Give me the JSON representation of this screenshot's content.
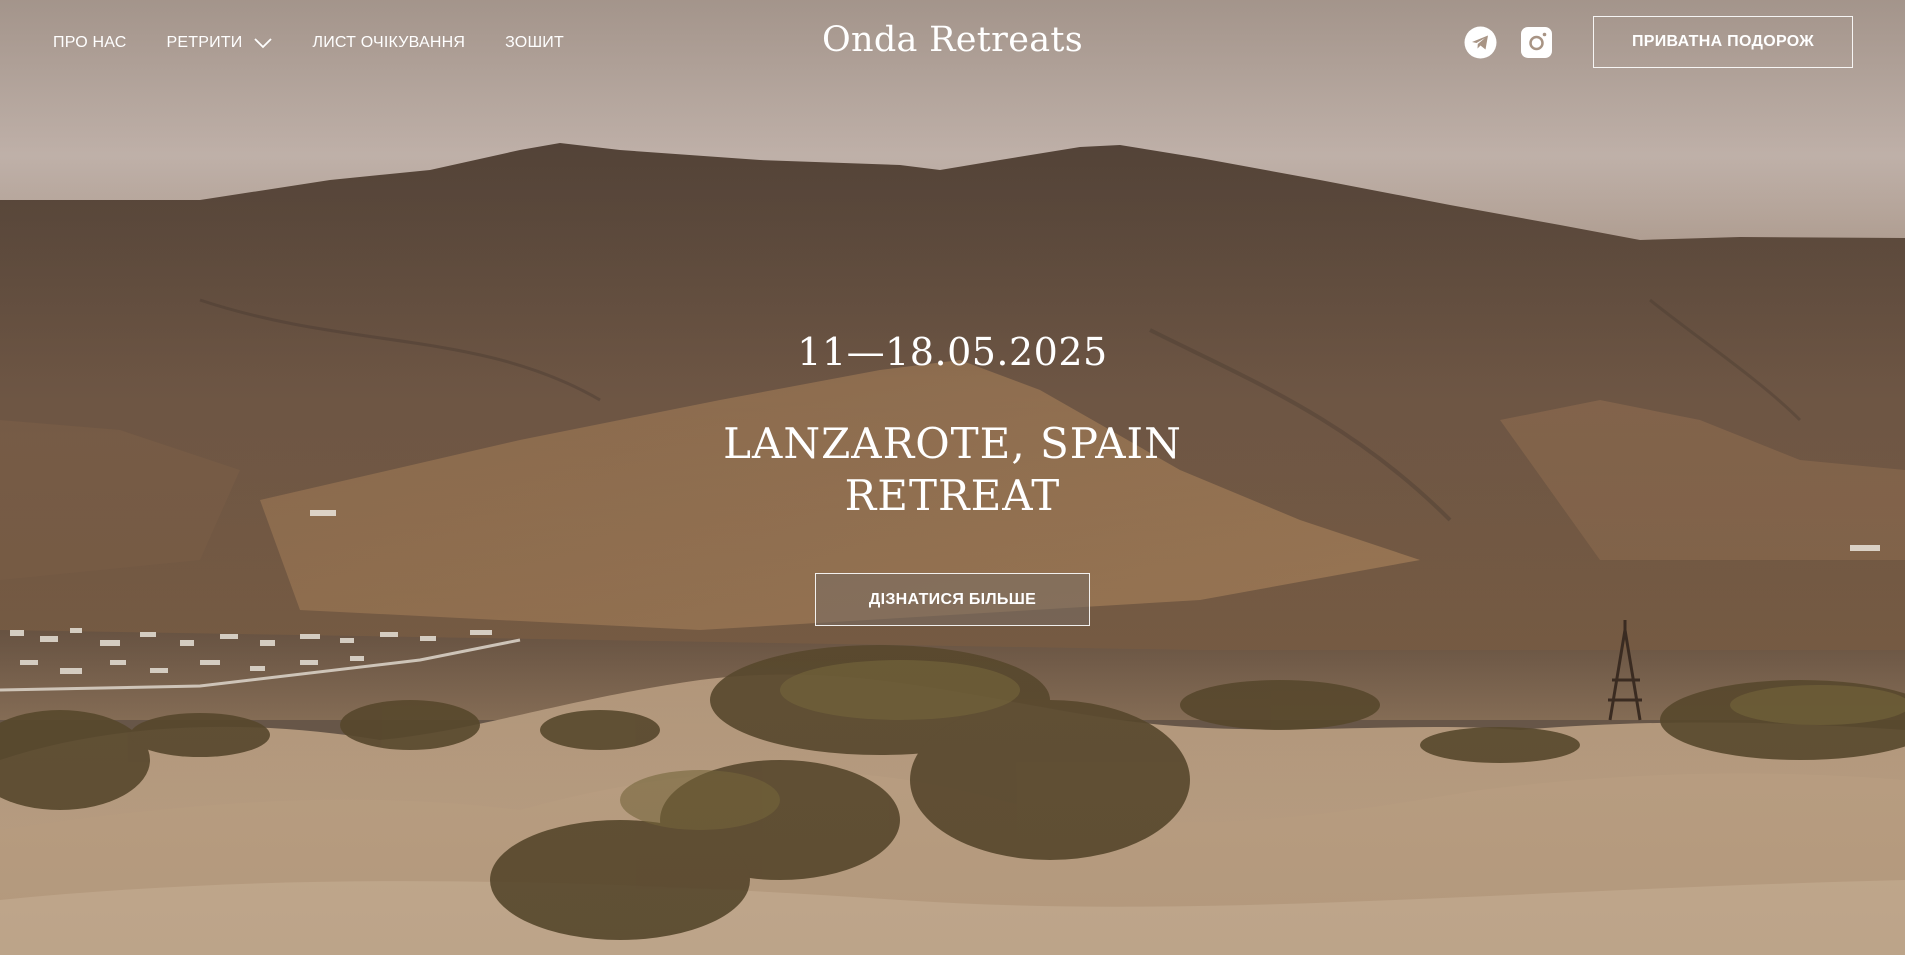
{
  "nav": {
    "items": [
      {
        "label": "ПРО НАС"
      },
      {
        "label": "РЕТРИТИ"
      },
      {
        "label": "ЛИСТ ОЧІКУВАННЯ"
      },
      {
        "label": "ЗОШИТ"
      }
    ]
  },
  "brand": {
    "name": "Onda Retreats"
  },
  "social": {
    "telegram_icon": "telegram-icon",
    "instagram_icon": "instagram-icon"
  },
  "header": {
    "private_trip_label": "ПРИВАТНА ПОДОРОЖ"
  },
  "hero": {
    "date": "11—18.05.2025",
    "title_line1": "LANZAROTE, SPAIN",
    "title_line2": "RETREAT",
    "cta_label": "ДІЗНАТИСЯ БІЛЬШЕ"
  },
  "colors": {
    "sky": "#d9c9bf",
    "mountain": "#6e5847",
    "sand": "#c9ae8f",
    "text": "#ffffff"
  }
}
